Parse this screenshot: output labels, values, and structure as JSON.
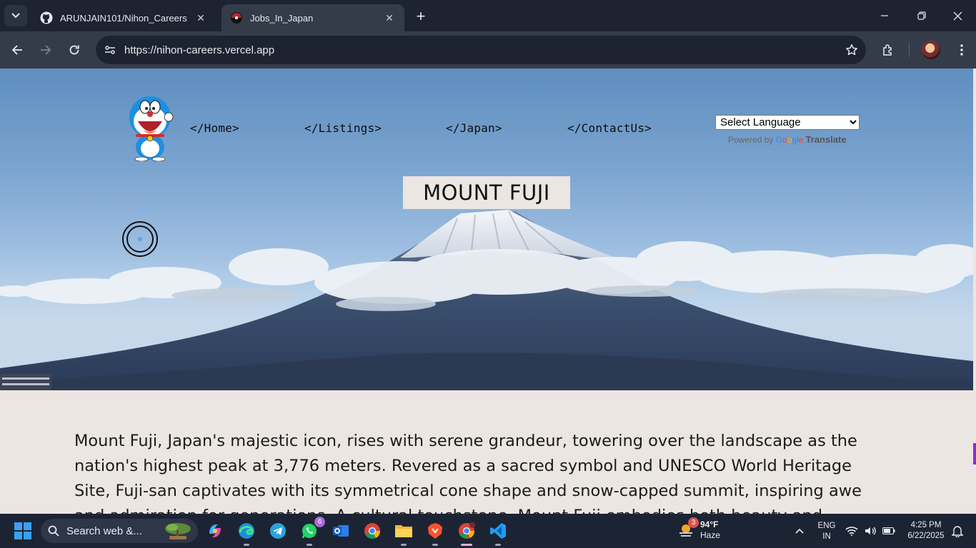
{
  "browser": {
    "tabs": [
      {
        "title": "ARUNJAIN101/Nihon_Careers",
        "icon": "github-icon",
        "active": false
      },
      {
        "title": "Jobs_In_Japan",
        "icon": "site-favicon",
        "active": true
      }
    ],
    "address": "https://nihon-careers.vercel.app"
  },
  "site": {
    "nav": [
      "</Home>",
      "</Listings>",
      "</Japan>",
      "</ContactUs>"
    ],
    "translate": {
      "select_label": "Select Language",
      "powered_by": "Powered by",
      "google": [
        "G",
        "o",
        "o",
        "g",
        "l",
        "e"
      ],
      "translate_word": "Translate"
    },
    "hero_title": "MOUNT FUJI",
    "intro": "Mount Fuji, Japan's majestic icon, rises with serene grandeur, towering over the landscape as the nation's highest peak at 3,776 meters. Revered as a sacred symbol and UNESCO World Heritage Site, Fuji-san captivates with its symmetrical cone shape and snow-capped summit, inspiring awe and admiration for generations. A cultural touchstone, Mount Fuji embodies both beauty and"
  },
  "taskbar": {
    "search_placeholder": "Search web &...",
    "whatsapp_badge": "6",
    "weather": {
      "badge": "3",
      "temp": "94°F",
      "condition": "Haze"
    },
    "language": {
      "line1": "ENG",
      "line2": "IN"
    },
    "clock": {
      "time": "4:25 PM",
      "date": "6/22/2025"
    }
  },
  "colors": {
    "accent": "#8a2be2",
    "chrome_bg": "#1d2330",
    "page_bg": "#ebe6e1"
  }
}
